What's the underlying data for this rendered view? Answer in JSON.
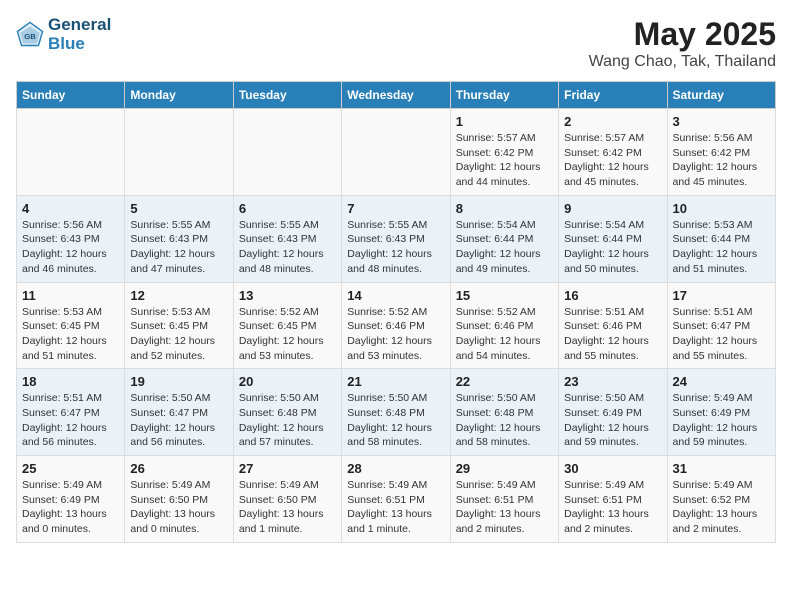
{
  "logo": {
    "line1": "General",
    "line2": "Blue"
  },
  "title": "May 2025",
  "subtitle": "Wang Chao, Tak, Thailand",
  "headers": [
    "Sunday",
    "Monday",
    "Tuesday",
    "Wednesday",
    "Thursday",
    "Friday",
    "Saturday"
  ],
  "weeks": [
    [
      {
        "num": "",
        "detail": ""
      },
      {
        "num": "",
        "detail": ""
      },
      {
        "num": "",
        "detail": ""
      },
      {
        "num": "",
        "detail": ""
      },
      {
        "num": "1",
        "detail": "Sunrise: 5:57 AM\nSunset: 6:42 PM\nDaylight: 12 hours\nand 44 minutes."
      },
      {
        "num": "2",
        "detail": "Sunrise: 5:57 AM\nSunset: 6:42 PM\nDaylight: 12 hours\nand 45 minutes."
      },
      {
        "num": "3",
        "detail": "Sunrise: 5:56 AM\nSunset: 6:42 PM\nDaylight: 12 hours\nand 45 minutes."
      }
    ],
    [
      {
        "num": "4",
        "detail": "Sunrise: 5:56 AM\nSunset: 6:43 PM\nDaylight: 12 hours\nand 46 minutes."
      },
      {
        "num": "5",
        "detail": "Sunrise: 5:55 AM\nSunset: 6:43 PM\nDaylight: 12 hours\nand 47 minutes."
      },
      {
        "num": "6",
        "detail": "Sunrise: 5:55 AM\nSunset: 6:43 PM\nDaylight: 12 hours\nand 48 minutes."
      },
      {
        "num": "7",
        "detail": "Sunrise: 5:55 AM\nSunset: 6:43 PM\nDaylight: 12 hours\nand 48 minutes."
      },
      {
        "num": "8",
        "detail": "Sunrise: 5:54 AM\nSunset: 6:44 PM\nDaylight: 12 hours\nand 49 minutes."
      },
      {
        "num": "9",
        "detail": "Sunrise: 5:54 AM\nSunset: 6:44 PM\nDaylight: 12 hours\nand 50 minutes."
      },
      {
        "num": "10",
        "detail": "Sunrise: 5:53 AM\nSunset: 6:44 PM\nDaylight: 12 hours\nand 51 minutes."
      }
    ],
    [
      {
        "num": "11",
        "detail": "Sunrise: 5:53 AM\nSunset: 6:45 PM\nDaylight: 12 hours\nand 51 minutes."
      },
      {
        "num": "12",
        "detail": "Sunrise: 5:53 AM\nSunset: 6:45 PM\nDaylight: 12 hours\nand 52 minutes."
      },
      {
        "num": "13",
        "detail": "Sunrise: 5:52 AM\nSunset: 6:45 PM\nDaylight: 12 hours\nand 53 minutes."
      },
      {
        "num": "14",
        "detail": "Sunrise: 5:52 AM\nSunset: 6:46 PM\nDaylight: 12 hours\nand 53 minutes."
      },
      {
        "num": "15",
        "detail": "Sunrise: 5:52 AM\nSunset: 6:46 PM\nDaylight: 12 hours\nand 54 minutes."
      },
      {
        "num": "16",
        "detail": "Sunrise: 5:51 AM\nSunset: 6:46 PM\nDaylight: 12 hours\nand 55 minutes."
      },
      {
        "num": "17",
        "detail": "Sunrise: 5:51 AM\nSunset: 6:47 PM\nDaylight: 12 hours\nand 55 minutes."
      }
    ],
    [
      {
        "num": "18",
        "detail": "Sunrise: 5:51 AM\nSunset: 6:47 PM\nDaylight: 12 hours\nand 56 minutes."
      },
      {
        "num": "19",
        "detail": "Sunrise: 5:50 AM\nSunset: 6:47 PM\nDaylight: 12 hours\nand 56 minutes."
      },
      {
        "num": "20",
        "detail": "Sunrise: 5:50 AM\nSunset: 6:48 PM\nDaylight: 12 hours\nand 57 minutes."
      },
      {
        "num": "21",
        "detail": "Sunrise: 5:50 AM\nSunset: 6:48 PM\nDaylight: 12 hours\nand 58 minutes."
      },
      {
        "num": "22",
        "detail": "Sunrise: 5:50 AM\nSunset: 6:48 PM\nDaylight: 12 hours\nand 58 minutes."
      },
      {
        "num": "23",
        "detail": "Sunrise: 5:50 AM\nSunset: 6:49 PM\nDaylight: 12 hours\nand 59 minutes."
      },
      {
        "num": "24",
        "detail": "Sunrise: 5:49 AM\nSunset: 6:49 PM\nDaylight: 12 hours\nand 59 minutes."
      }
    ],
    [
      {
        "num": "25",
        "detail": "Sunrise: 5:49 AM\nSunset: 6:49 PM\nDaylight: 13 hours\nand 0 minutes."
      },
      {
        "num": "26",
        "detail": "Sunrise: 5:49 AM\nSunset: 6:50 PM\nDaylight: 13 hours\nand 0 minutes."
      },
      {
        "num": "27",
        "detail": "Sunrise: 5:49 AM\nSunset: 6:50 PM\nDaylight: 13 hours\nand 1 minute."
      },
      {
        "num": "28",
        "detail": "Sunrise: 5:49 AM\nSunset: 6:51 PM\nDaylight: 13 hours\nand 1 minute."
      },
      {
        "num": "29",
        "detail": "Sunrise: 5:49 AM\nSunset: 6:51 PM\nDaylight: 13 hours\nand 2 minutes."
      },
      {
        "num": "30",
        "detail": "Sunrise: 5:49 AM\nSunset: 6:51 PM\nDaylight: 13 hours\nand 2 minutes."
      },
      {
        "num": "31",
        "detail": "Sunrise: 5:49 AM\nSunset: 6:52 PM\nDaylight: 13 hours\nand 2 minutes."
      }
    ]
  ]
}
